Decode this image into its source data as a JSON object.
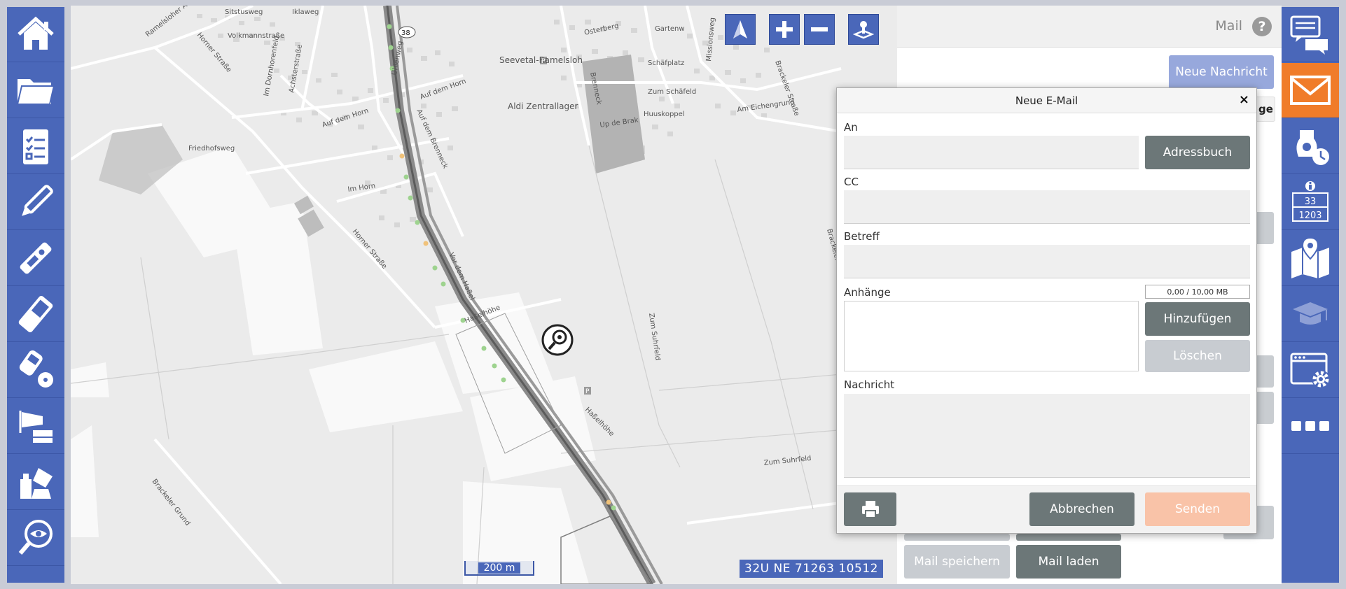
{
  "map": {
    "street_labels": [
      "Sitstusweg",
      "Iklaweg",
      "Volkmannstraße",
      "Ramelsloher Al.",
      "Horner Straße",
      "Im Dornhorenfeld",
      "Achsterstraße",
      "Uhlenweg",
      "Auf dem Horn",
      "Auf dem Horn",
      "Auf dem Brenneck",
      "Friedhofsweg",
      "Im Horn",
      "Horner Straße",
      "Vor dem Haßel",
      "Haßelhöhe",
      "Osterberg",
      "Gartenw",
      "Missionsweg",
      "Brenneck",
      "Schäfplatz",
      "Zum Schäfeld",
      "Huuskoppel",
      "Am Eichengrund",
      "Up de Brak",
      "Brackeler Straße",
      "Zum Suhrfeld",
      "Haßelhöhe",
      "Zum Suhrfeld",
      "Brackeler Grund",
      "Brackeler Straße"
    ],
    "poi_labels": [
      "Seevetal-Ramelsloh",
      "Aldi Zentrallager"
    ],
    "parking_label": "P",
    "road_shield": "38",
    "scale_label": "200 m",
    "coordinates": "32U NE 71263 10512",
    "controls": [
      "compass-icon",
      "zoom-in-icon",
      "zoom-out-icon",
      "joystick-icon"
    ]
  },
  "mail_panel": {
    "title": "Mail",
    "help": "?",
    "new_message_label": "Neue Nachricht",
    "save_mail_label": "Mail speichern",
    "load_mail_label": "Mail laden",
    "partial_header": "ge"
  },
  "dialog": {
    "title": "Neue E-Mail",
    "close": "×",
    "to_label": "An",
    "to_value": "",
    "address_book_label": "Adressbuch",
    "cc_label": "CC",
    "cc_value": "",
    "subject_label": "Betreff",
    "subject_value": "",
    "attachments_label": "Anhänge",
    "size_indicator": "0,00 / 10,00 MB",
    "add_label": "Hinzufügen",
    "delete_label": "Löschen",
    "message_label": "Nachricht",
    "message_value": "",
    "cancel_label": "Abbrechen",
    "send_label": "Senden"
  },
  "left_sidebar": {
    "items": [
      "home-icon",
      "folder-icon",
      "checklist-icon",
      "pen-icon",
      "gas-detector-icon",
      "phone-icon",
      "radiation-meter-icon",
      "windsock-icon",
      "chemicals-icon",
      "observer-search-icon"
    ]
  },
  "right_sidebar": {
    "items": [
      "chat-icon",
      "mail-icon",
      "breathing-apparatus-timer-icon",
      "info-un-number-icon",
      "map-pin-icon",
      "graduation-cap-icon",
      "settings-window-icon",
      "more-icon"
    ],
    "un_number_top": "33",
    "un_number_bottom": "1203",
    "active": "mail-icon"
  },
  "colors": {
    "sidebar_blue": "#4a67b9",
    "active_orange": "#f07c2a",
    "button_gray": "#6c7778",
    "button_light": "#c8ccd1",
    "send_disabled": "#f9c3a8",
    "new_message": "#97a8dc"
  }
}
